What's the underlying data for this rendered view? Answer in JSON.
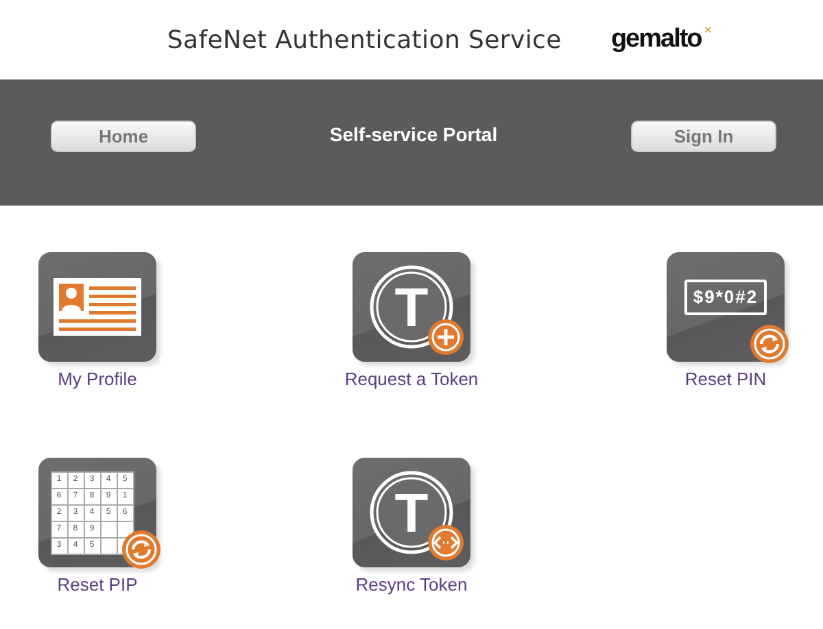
{
  "header": {
    "title": "SafeNet Authentication Service",
    "logo": "gemalto",
    "logo_mark": "×"
  },
  "navbar": {
    "home_button": "Home",
    "title": "Self-service Portal",
    "signin_button": "Sign In"
  },
  "tiles": [
    {
      "kind": "profile",
      "label": "My Profile"
    },
    {
      "kind": "token-add",
      "label": "Request a Token",
      "icon_text": "T"
    },
    {
      "kind": "pin",
      "label": "Reset PIN",
      "icon_text": "$9*0#2"
    },
    {
      "kind": "grid",
      "label": "Reset PIP",
      "grid": [
        [
          "1",
          "2",
          "3",
          "4",
          "5"
        ],
        [
          "6",
          "7",
          "8",
          "9",
          "1"
        ],
        [
          "2",
          "3",
          "4",
          "5",
          "6"
        ],
        [
          "7",
          "8",
          "9"
        ],
        [
          "3",
          "4",
          "5"
        ]
      ]
    },
    {
      "kind": "token-sync",
      "label": "Resync Token",
      "icon_text": "T"
    }
  ]
}
